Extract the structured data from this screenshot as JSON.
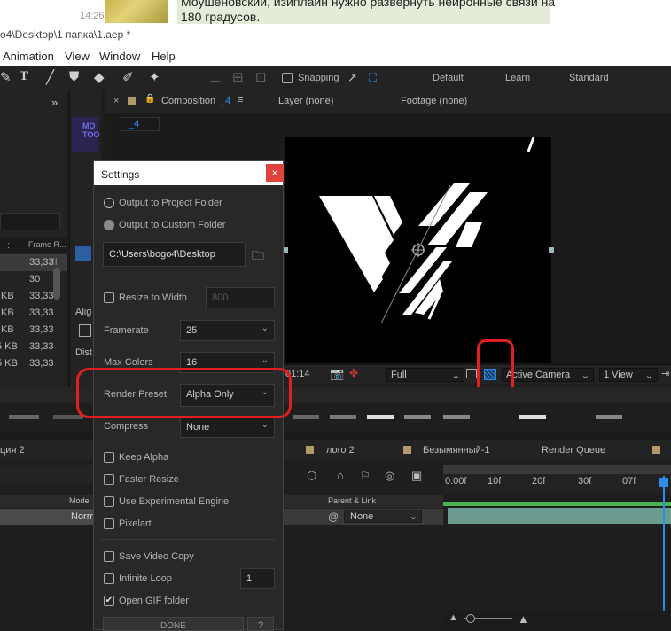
{
  "chat": {
    "time": "14:26",
    "message_line1": "Моушеновский, изиплайн нужно развернуть нейронные связи на",
    "message_line2": "180 градусов."
  },
  "window": {
    "title": "o4\\Desktop\\1 папка\\1.aep *"
  },
  "menu": [
    "Animation",
    "View",
    "Window",
    "Help"
  ],
  "toolbar": {
    "snapping": "Snapping",
    "workspaces": [
      "Default",
      "Learn",
      "Standard"
    ]
  },
  "left_panel": {
    "col_header": "Frame R...",
    "rows": [
      {
        "size": "",
        "rate": "33,33"
      },
      {
        "size": "",
        "rate": "30"
      },
      {
        "size": "KB",
        "rate": "33,33"
      },
      {
        "size": "KB",
        "rate": "33,33"
      },
      {
        "size": "KB",
        "rate": "33,33"
      },
      {
        "size": "5 KB",
        "rate": "33,33"
      },
      {
        "size": "5 KB",
        "rate": "33,33"
      }
    ],
    "align_label": "Alig",
    "dist_label": "Dist",
    "motion_tools_label": "MO TOO"
  },
  "composition": {
    "tab_label": "Composition",
    "tab_name": "_4",
    "layer_tab": "Layer (none)",
    "footage_tab": "Footage (none)",
    "breadcrumb": "_4",
    "timecode": "01:14",
    "resolution": "Full",
    "camera": "Active Camera",
    "views": "1 View"
  },
  "timeline": {
    "tabs": [
      "ция 2",
      "лого 2",
      "Безымянный-1",
      "Render Queue"
    ],
    "mode_header": "Mode",
    "mode_value": "Norm",
    "parent_header": "Parent & Link",
    "parent_value": "None",
    "ruler": [
      "0:00f",
      "10f",
      "20f",
      "30f",
      "07f"
    ]
  },
  "settings": {
    "title": "Settings",
    "close": "×",
    "output_project": "Output to Project Folder",
    "output_custom": "Output to Custom Folder",
    "path": "C:\\Users\\bogo4\\Desktop",
    "resize_label": "Resize to Width",
    "resize_value": "800",
    "framerate_label": "Framerate",
    "framerate_value": "25",
    "max_colors_label": "Max Colors",
    "max_colors_value": "16",
    "render_preset_label": "Render Preset",
    "render_preset_value": "Alpha Only",
    "compress_label": "Compress",
    "compress_value": "None",
    "keep_alpha": "Keep Alpha",
    "faster_resize": "Faster Resize",
    "experimental": "Use Experimental Engine",
    "pixelart": "Pixelart",
    "save_video": "Save Video Copy",
    "infinite_loop": "Infinite Loop",
    "loop_value": "1",
    "open_gif": "Open GIF folder",
    "done": "DONE",
    "help": "?"
  },
  "colors": {
    "highlight": "#e02020",
    "accent_blue": "#2d8ceb"
  }
}
